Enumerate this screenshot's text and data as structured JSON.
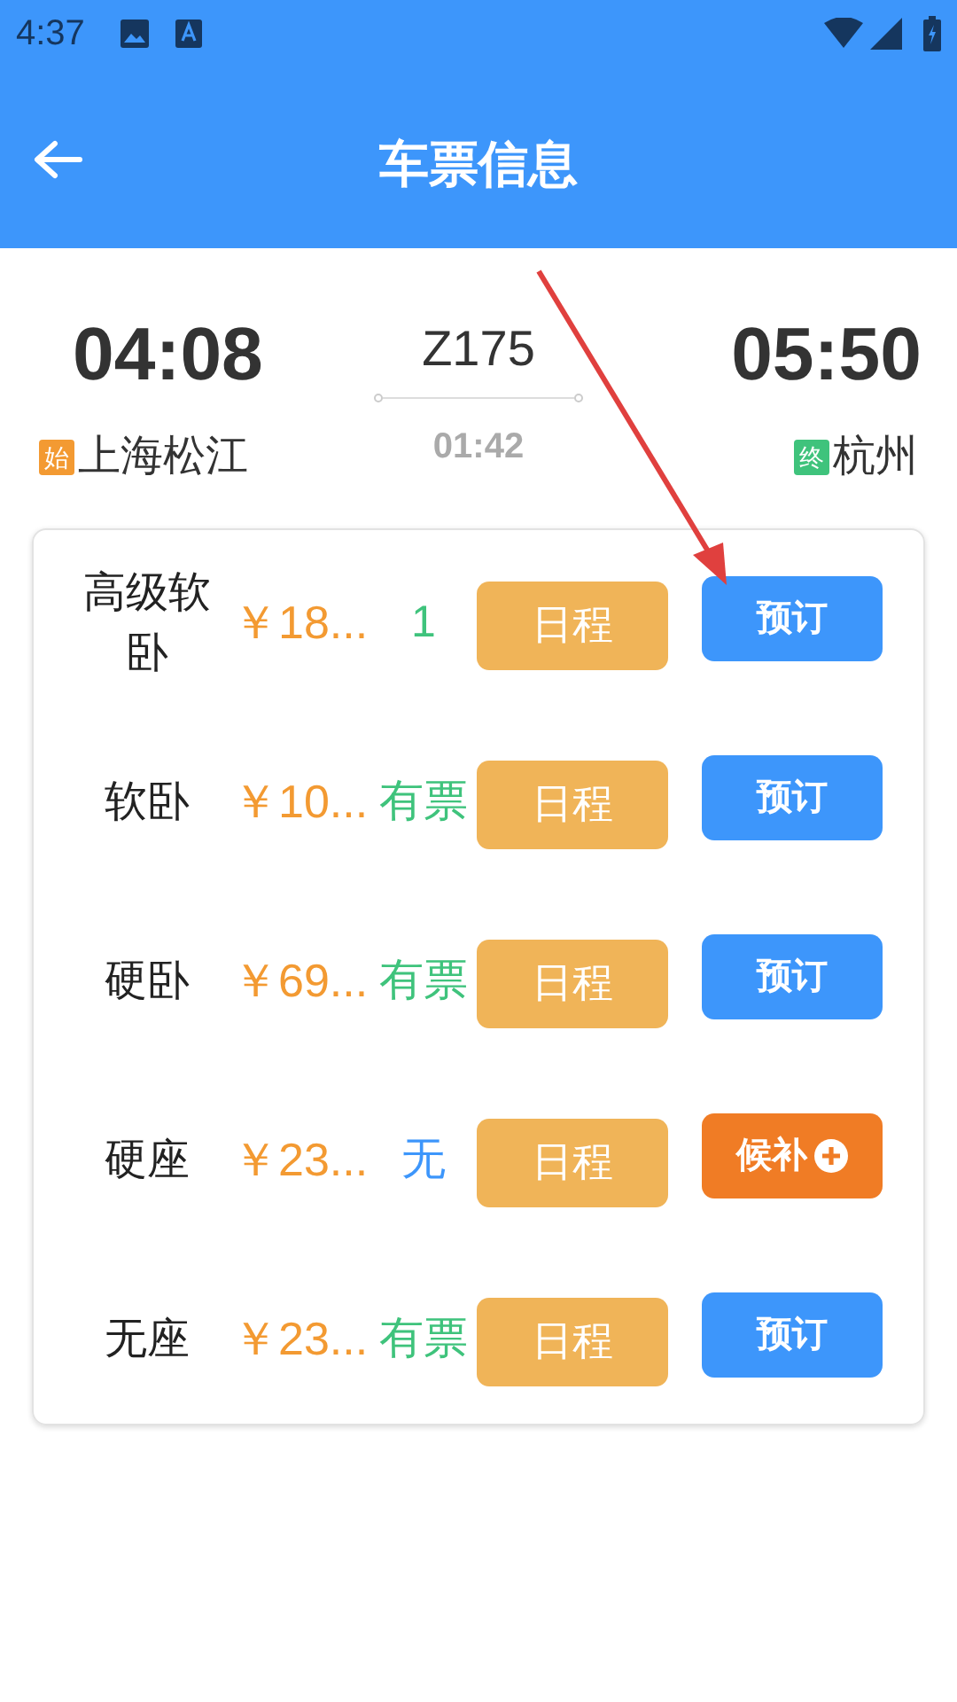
{
  "status_bar": {
    "time": "4:37"
  },
  "header": {
    "title": "车票信息"
  },
  "trip": {
    "depart_time": "04:08",
    "train": "Z175",
    "arrive_time": "05:50",
    "duration": "01:42",
    "origin": {
      "badge": "始",
      "name": "上海松江",
      "color": "#f39a32"
    },
    "destination": {
      "badge": "终",
      "name": "杭州",
      "color": "#3fc37c"
    }
  },
  "seats": [
    {
      "name": "高级软卧",
      "price": "￥18...",
      "availability": "1",
      "color": "#3fc37c",
      "schedule": "日程",
      "action": {
        "kind": "book",
        "label": "预订"
      }
    },
    {
      "name": "软卧",
      "price": "￥10...",
      "availability": "有票",
      "color": "#3fc37c",
      "schedule": "日程",
      "action": {
        "kind": "book",
        "label": "预订"
      }
    },
    {
      "name": "硬卧",
      "price": "￥69...",
      "availability": "有票",
      "color": "#3fc37c",
      "schedule": "日程",
      "action": {
        "kind": "book",
        "label": "预订"
      }
    },
    {
      "name": "硬座",
      "price": "￥23...",
      "availability": "无",
      "color": "#3d96fb",
      "schedule": "日程",
      "action": {
        "kind": "waitlist",
        "label": "候补"
      }
    },
    {
      "name": "无座",
      "price": "￥23...",
      "availability": "有票",
      "color": "#3fc37c",
      "schedule": "日程",
      "action": {
        "kind": "book",
        "label": "预订"
      }
    }
  ]
}
